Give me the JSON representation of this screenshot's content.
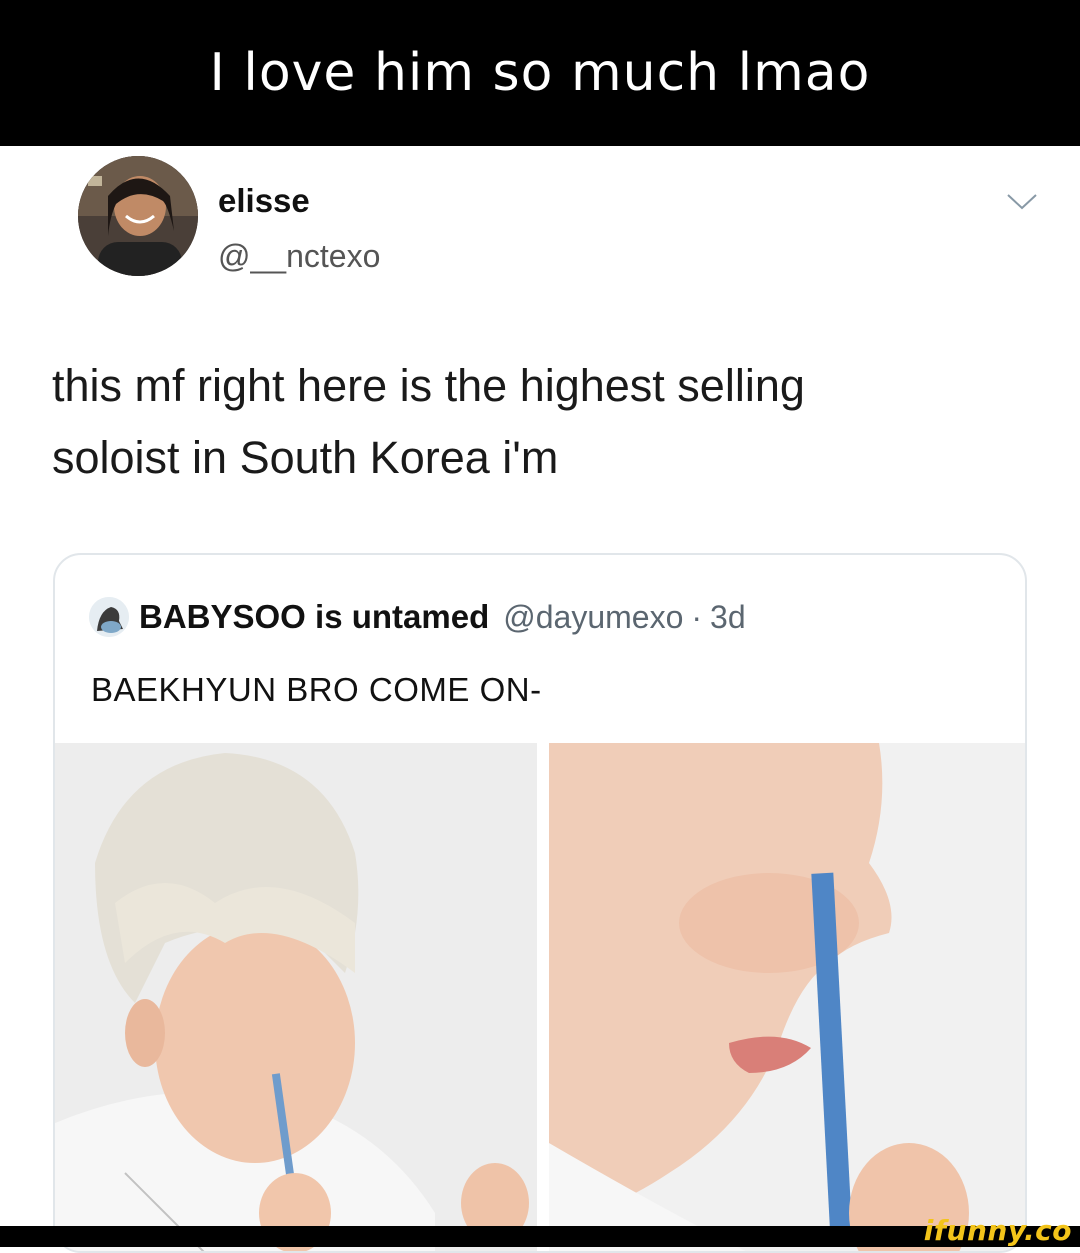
{
  "caption": "I love him so much lmao",
  "tweet": {
    "display_name": "elisse",
    "handle": "@__nctexo",
    "text_line1": "this mf right here is the highest selling",
    "text_line2": "soloist in South Korea i'm",
    "menu_icon": "chevron-down-icon"
  },
  "quoted_tweet": {
    "display_name": "BABYSOO is untamed",
    "handle": "@dayumexo",
    "separator": "·",
    "time": "3d",
    "text": "BAEKHYUN BRO COME ON-"
  },
  "watermark": "ifunny.co",
  "colors": {
    "caption_bg": "#000000",
    "caption_text": "#ffffff",
    "watermark": "#f3c41a",
    "card_border": "#e1e6ea"
  }
}
